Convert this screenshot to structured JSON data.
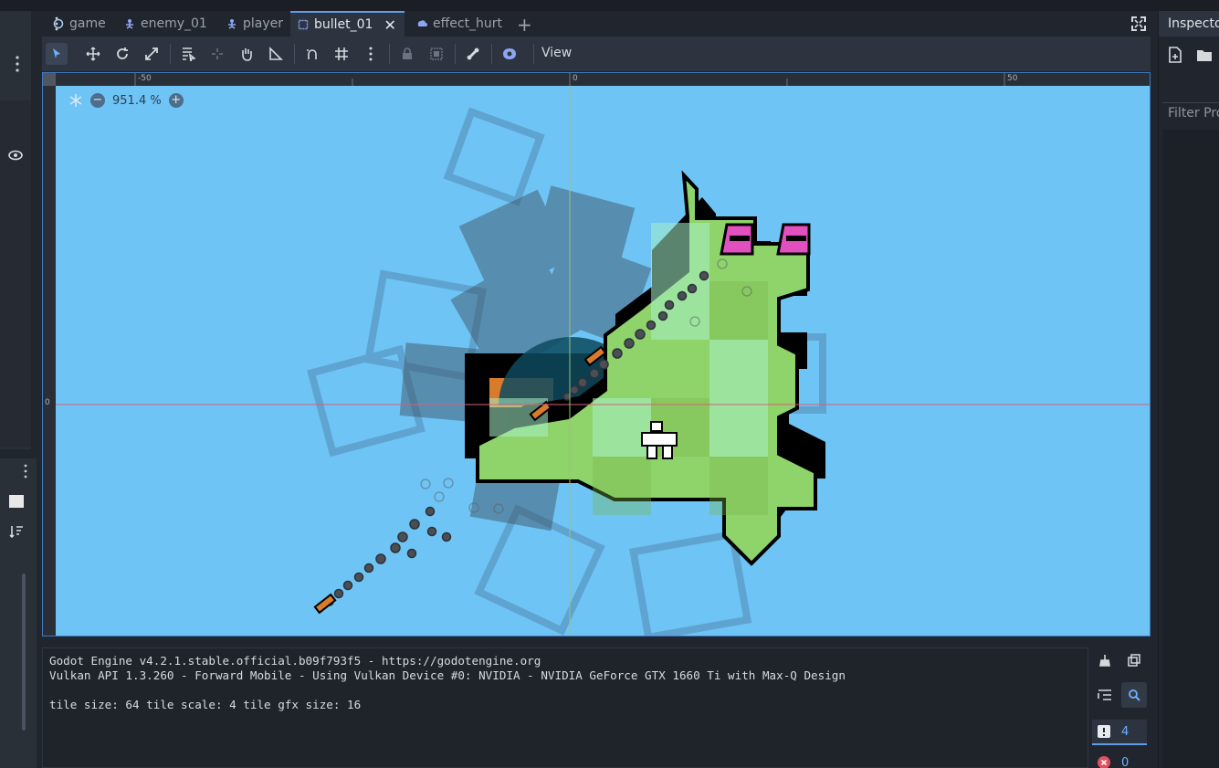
{
  "tabs": [
    {
      "label": "game",
      "icon": "node-circle-icon",
      "active": false
    },
    {
      "label": "enemy_01",
      "icon": "character-icon",
      "active": false
    },
    {
      "label": "player",
      "icon": "character-icon",
      "active": false
    },
    {
      "label": "bullet_01",
      "icon": "area-icon",
      "active": true
    },
    {
      "label": "effect_hurt",
      "icon": "particles-icon",
      "active": false
    }
  ],
  "toolbar": {
    "view_label": "View",
    "tools": [
      "select-icon",
      "move-icon",
      "rotate-icon",
      "scale-icon",
      "list-select-icon",
      "pivot-icon",
      "pan-icon",
      "ruler-icon",
      "smart-snap-icon",
      "grid-snap-icon",
      "more-icon",
      "lock-icon",
      "group-icon",
      "bone-icon",
      "camera-override-icon"
    ]
  },
  "viewport": {
    "zoom_label": "951.4 %",
    "ruler_labels": [
      "-50",
      "0",
      "50"
    ],
    "ruler_left_label": "0",
    "background_color": "#6ec4f5"
  },
  "output": {
    "lines": [
      "Godot Engine v4.2.1.stable.official.b09f793f5 - https://godotengine.org",
      "Vulkan API 1.3.260 - Forward Mobile - Using Vulkan Device #0: NVIDIA - NVIDIA GeForce GTX 1660 Ti with Max-Q Design",
      "",
      "tile size: 64 tile scale: 4 tile gfx size: 16"
    ],
    "warning_count": "4",
    "error_count": "0"
  },
  "inspector": {
    "title": "Inspector",
    "filter_placeholder": "Filter Properties"
  }
}
